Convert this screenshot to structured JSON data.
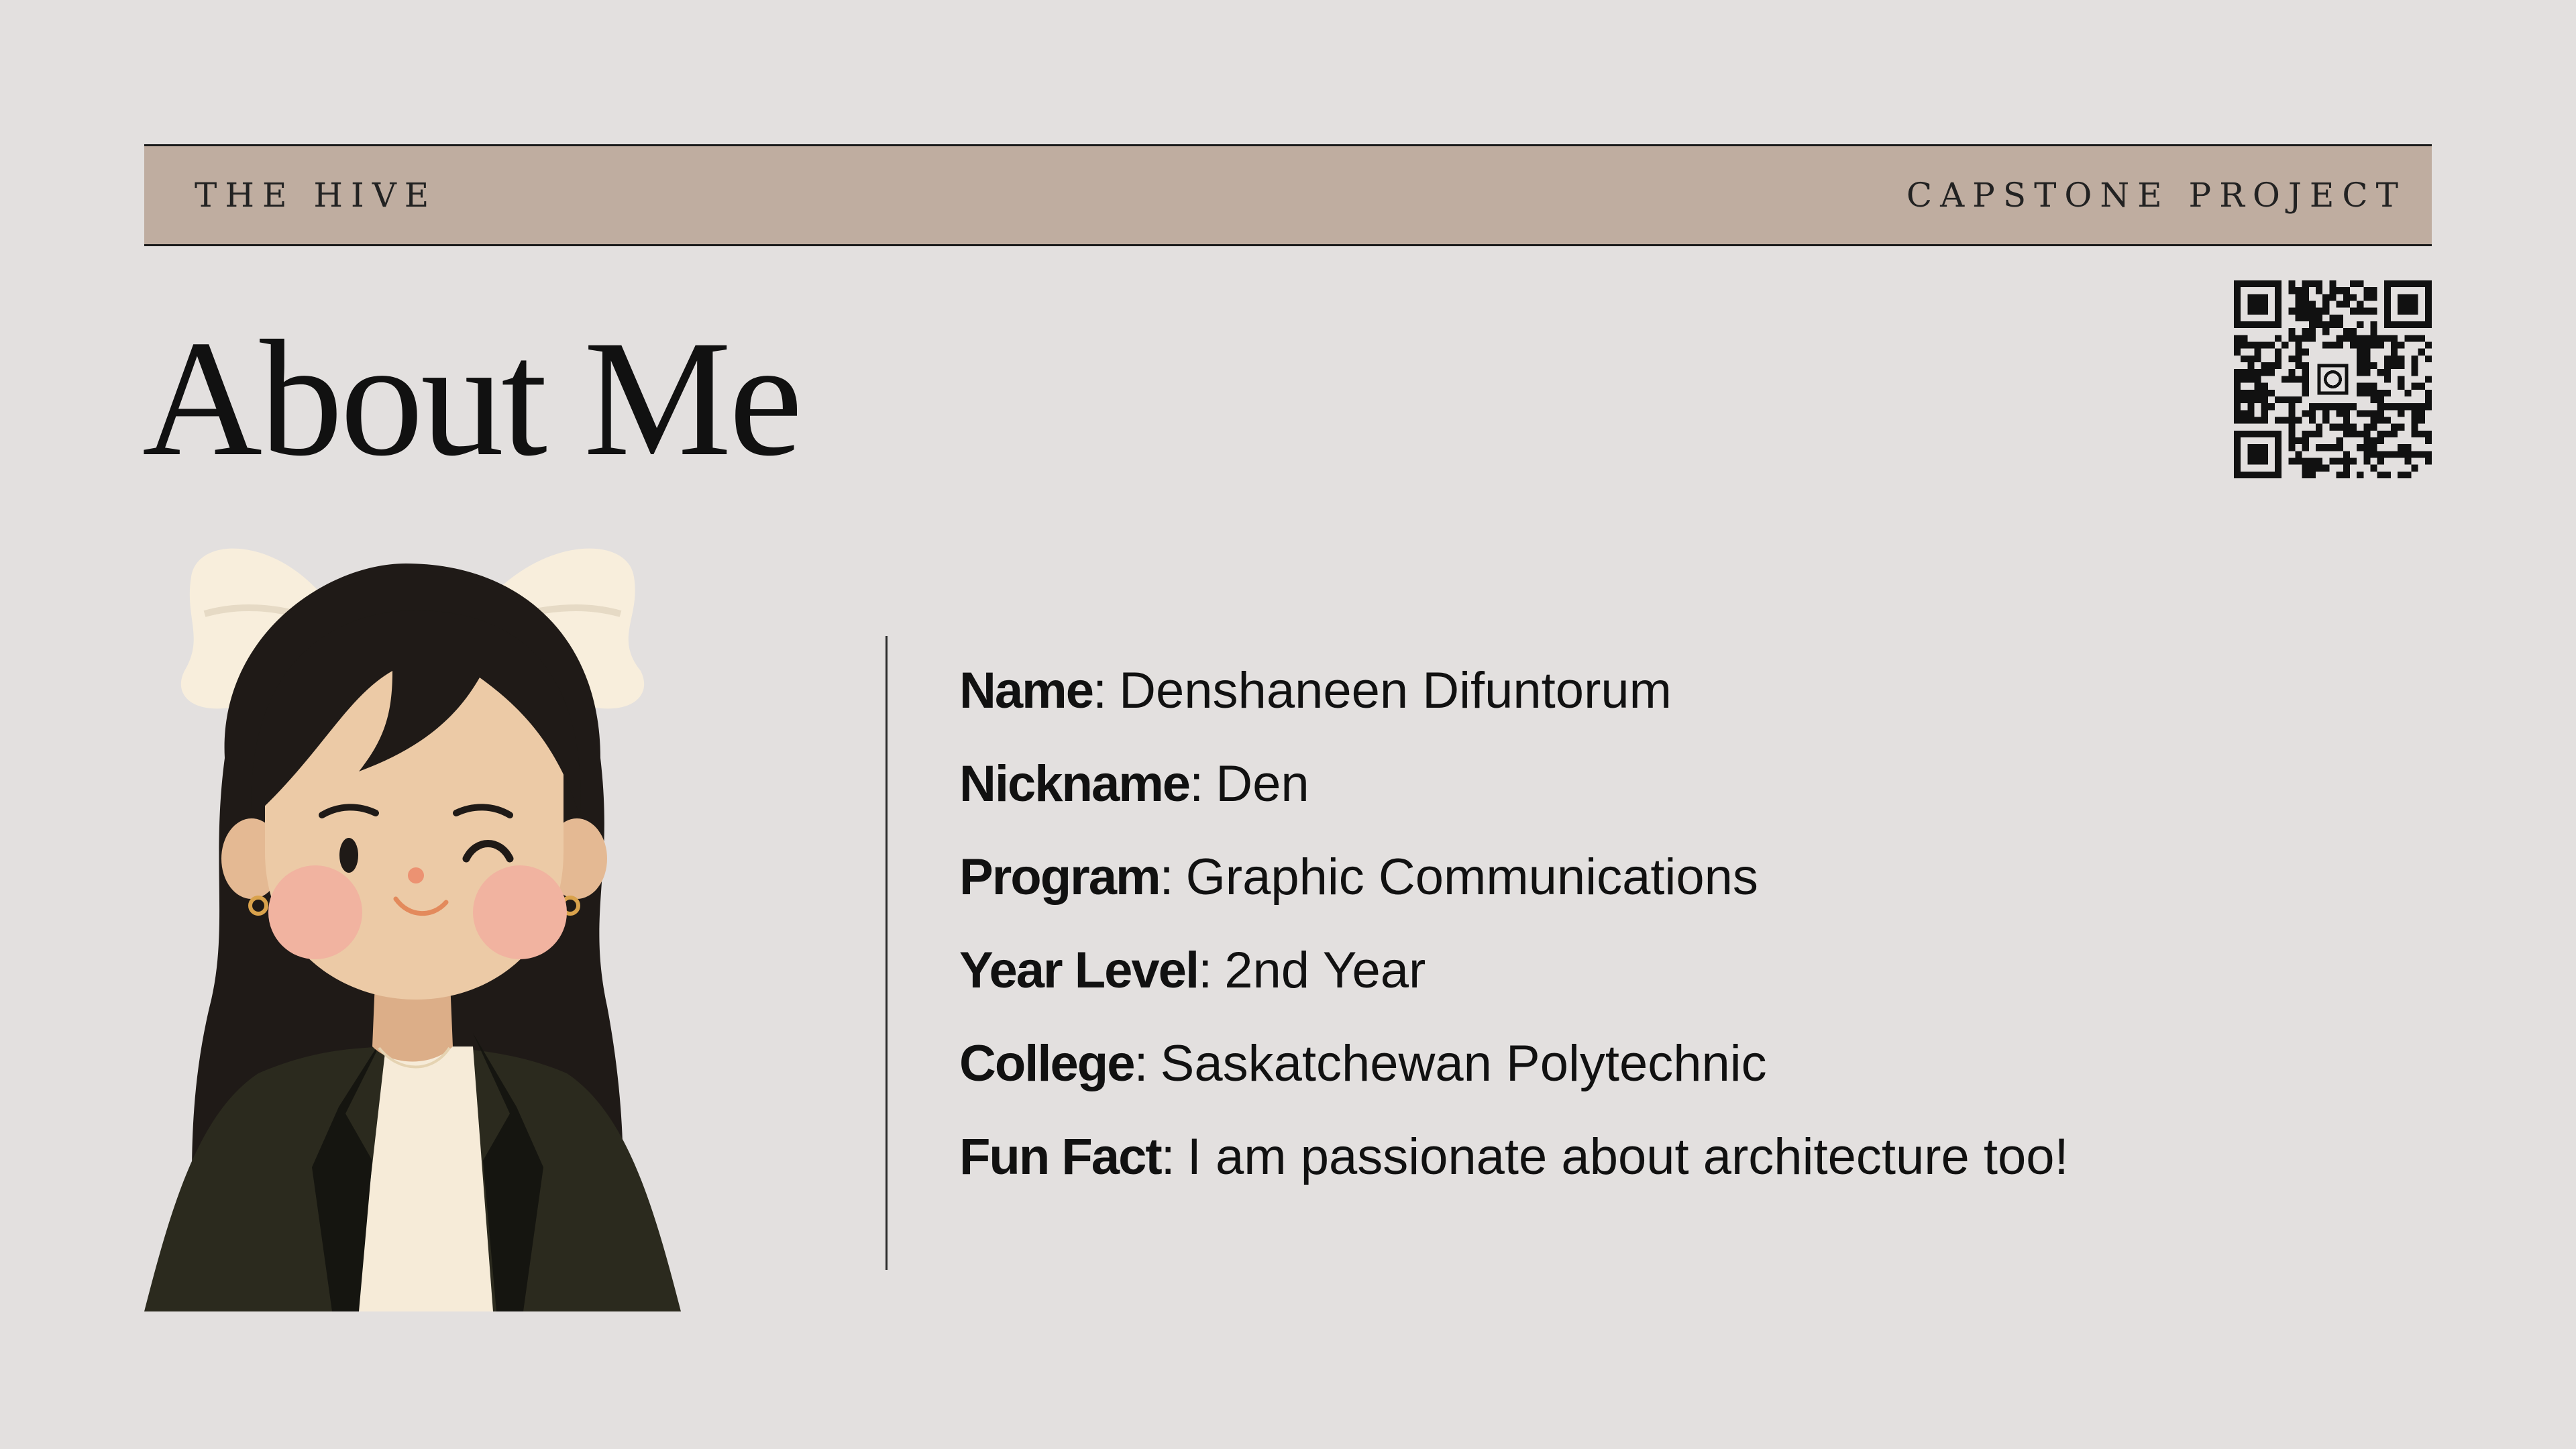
{
  "header": {
    "left": "THE HIVE",
    "right": "CAPSTONE PROJECT"
  },
  "title": "About Me",
  "qr_code": {
    "icon": "qr-code-icon"
  },
  "avatar": {
    "icon": "girl-avatar-illustration"
  },
  "details": [
    {
      "label": "Name",
      "value": "Denshaneen Difuntorum"
    },
    {
      "label": "Nickname",
      "value": "Den"
    },
    {
      "label": "Program",
      "value": "Graphic Communications"
    },
    {
      "label": "Year Level",
      "value": "2nd Year"
    },
    {
      "label": "College",
      "value": "Saskatchewan Polytechnic"
    },
    {
      "label": "Fun Fact",
      "value": "I am passionate about architecture too!"
    }
  ],
  "separator": ":",
  "colors": {
    "background": "#e3e0df",
    "band": "#bfada0",
    "text": "#111111",
    "hair": "#1f1a17",
    "blazer": "#2b2a1e",
    "bow": "#f8eedc",
    "skin": "#eccaa6",
    "blush": "#f1b3a0"
  }
}
